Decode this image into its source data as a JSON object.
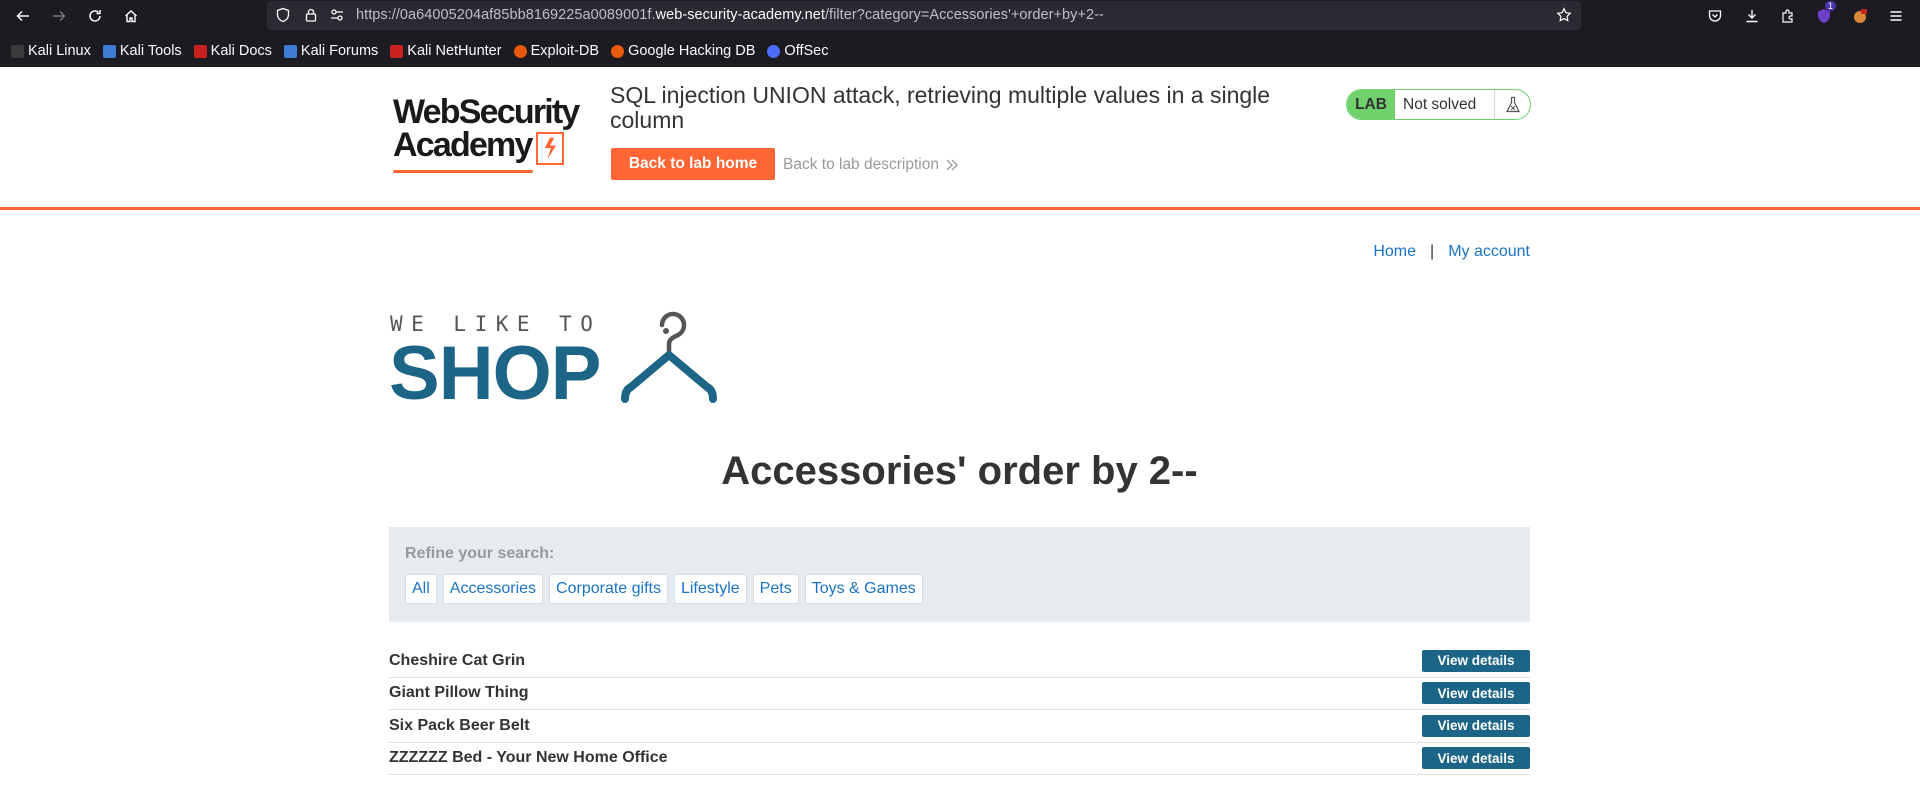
{
  "browser": {
    "url_prefix": "https://0a64005204af85bb8169225a0089001f.",
    "url_host": "web-security-academy.net",
    "url_path": "/filter?category=Accessories'+order+by+2--",
    "extension_badge": "1",
    "bookmarks": [
      {
        "label": "Kali Linux",
        "icon": "kali-dragon-icon",
        "color": "#3b3b3b"
      },
      {
        "label": "Kali Tools",
        "icon": "kali-tools-icon",
        "color": "#3f7cd6"
      },
      {
        "label": "Kali Docs",
        "icon": "kali-docs-icon",
        "color": "#c9211e"
      },
      {
        "label": "Kali Forums",
        "icon": "kali-forums-icon",
        "color": "#3f7cd6"
      },
      {
        "label": "Kali NetHunter",
        "icon": "kali-nethunter-icon",
        "color": "#c9211e"
      },
      {
        "label": "Exploit-DB",
        "icon": "exploit-db-icon",
        "color": "#e8590c"
      },
      {
        "label": "Google Hacking DB",
        "icon": "ghdb-icon",
        "color": "#e8590c"
      },
      {
        "label": "OffSec",
        "icon": "offsec-icon",
        "color": "#4a6cf7"
      }
    ]
  },
  "lab": {
    "logo_line1": "WebSecurity",
    "logo_line2": "Academy",
    "title": "SQL injection UNION attack, retrieving multiple values in a single column",
    "back_home": "Back to lab home",
    "back_description": "Back to lab description",
    "badge": "LAB",
    "status": "Not solved",
    "accent_color": "#ff6633",
    "solved_color": "#70d16d"
  },
  "nav": {
    "home": "Home",
    "separator": "|",
    "account": "My account"
  },
  "shop_logo": {
    "tagline": "WE LIKE TO",
    "word": "SHOP"
  },
  "heading": "Accessories' order by 2--",
  "refine": {
    "label": "Refine your search:",
    "filters": [
      "All",
      "Accessories",
      "Corporate gifts",
      "Lifestyle",
      "Pets",
      "Toys & Games"
    ]
  },
  "products": [
    {
      "name": "Cheshire Cat Grin",
      "button": "View details"
    },
    {
      "name": "Giant Pillow Thing",
      "button": "View details"
    },
    {
      "name": "Six Pack Beer Belt",
      "button": "View details"
    },
    {
      "name": "ZZZZZZ Bed - Your New Home Office",
      "button": "View details"
    }
  ]
}
